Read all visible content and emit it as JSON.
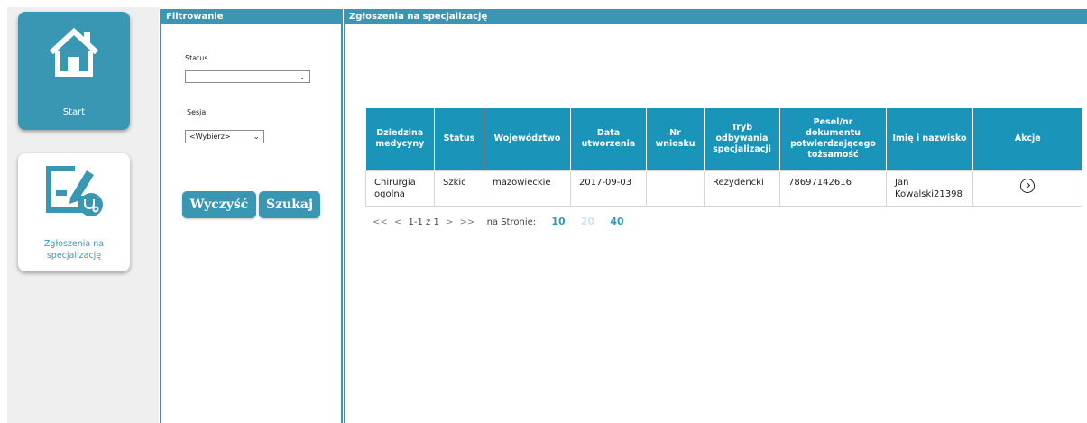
{
  "nav": {
    "start_label": "Start",
    "zgloszenia_label": "Zgłoszenia na specjalizację"
  },
  "filter": {
    "title": "Filtrowanie",
    "status_label": "Status",
    "status_value": "",
    "sesja_label": "Sesja",
    "sesja_value": "<Wybierz>",
    "clear_button": "Wyczyść",
    "search_button": "Szukaj"
  },
  "main": {
    "title": "Zgłoszenia na specjalizację",
    "table": {
      "headers": [
        "Dziedzina medycyny",
        "Status",
        "Województwo",
        "Data utworzenia",
        "Nr wniosku",
        "Tryb odbywania specjalizacji",
        "Pesel/nr dokumentu potwierdzającego tożsamość",
        "Imię i nazwisko",
        "Akcje"
      ],
      "rows": [
        [
          "Chirurgia ogolna",
          "Szkic",
          "mazowieckie",
          "2017-09-03",
          "",
          "Rezydencki",
          "78697142616",
          "Jan Kowalski21398",
          ""
        ]
      ]
    },
    "pager": {
      "first": "<<",
      "prev": "<",
      "info": "1-1 z 1",
      "next": ">",
      "last": ">>",
      "per_page_label": "na Stronie:",
      "sizes": [
        "10",
        "20",
        "40"
      ]
    }
  },
  "colors": {
    "accent": "#3a97b4",
    "table_header": "#1a94b8"
  }
}
